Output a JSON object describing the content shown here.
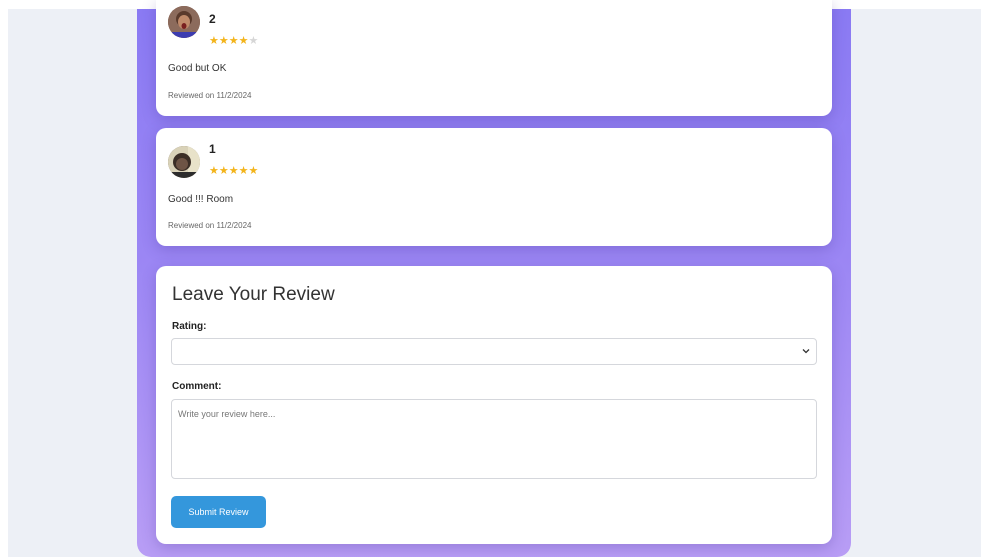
{
  "reviews": [
    {
      "name": "2",
      "rating": 4,
      "max_rating": 5,
      "comment": "Good but OK",
      "reviewed_on": "Reviewed on 11/2/2024"
    },
    {
      "name": "1",
      "rating": 5,
      "max_rating": 5,
      "comment": "Good !!! Room",
      "reviewed_on": "Reviewed on 11/2/2024"
    }
  ],
  "form": {
    "title": "Leave Your Review",
    "rating_label": "Rating:",
    "rating_value": "",
    "comment_label": "Comment:",
    "comment_placeholder": "Write your review here...",
    "submit_label": "Submit Review"
  },
  "colors": {
    "star_filled": "#f3b41b",
    "star_empty": "#d6d6d6",
    "submit_button": "#3497dc",
    "panel_gradient_top": "#8a7af3",
    "panel_gradient_bottom": "#b89df5"
  },
  "icons": {
    "select_arrow": "chevron-down-icon",
    "star": "star-icon"
  }
}
